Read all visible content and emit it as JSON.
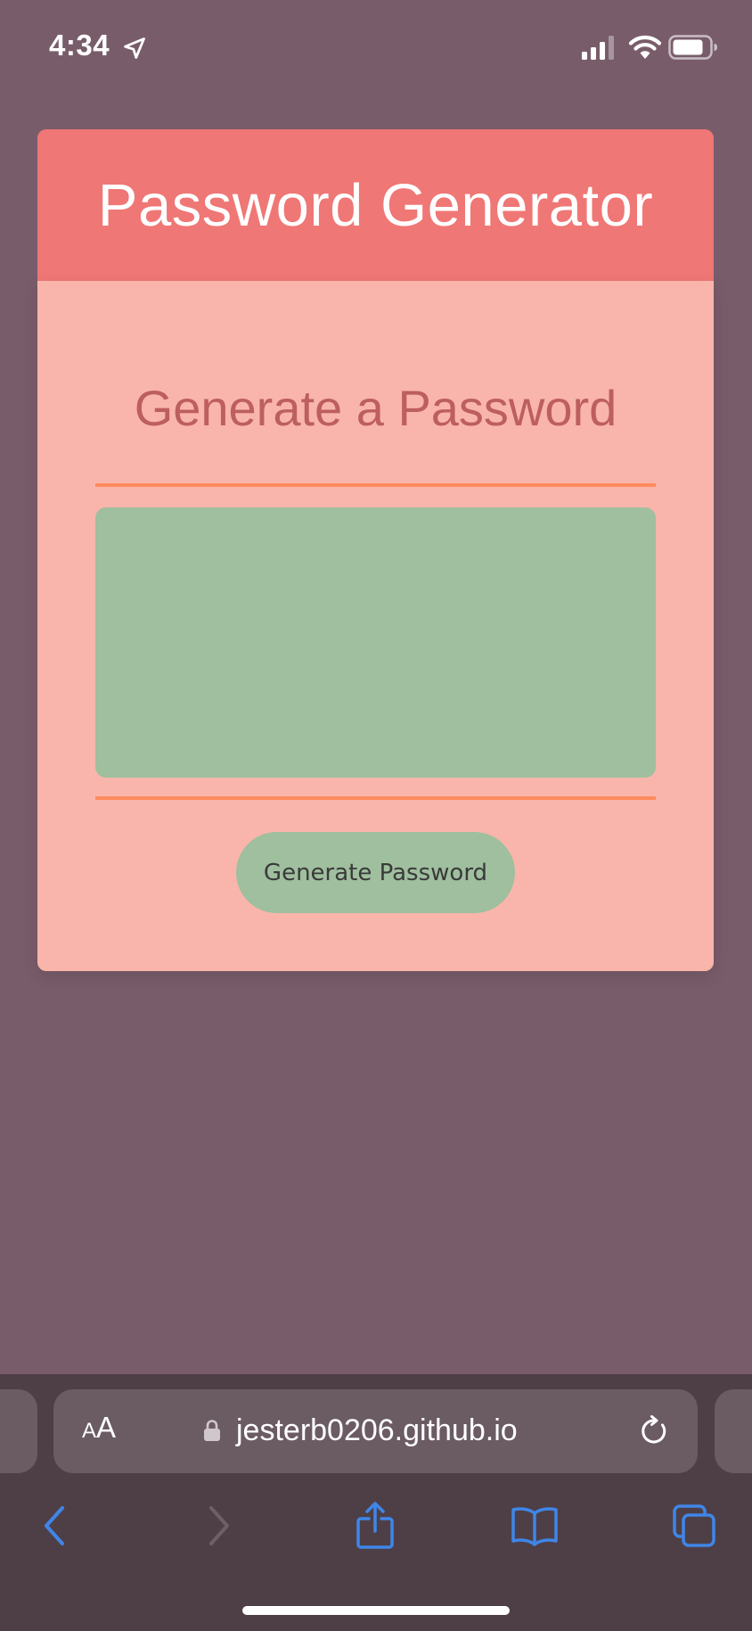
{
  "status_bar": {
    "time": "4:34",
    "icons": [
      "location-arrow-icon",
      "cellular-signal-icon",
      "wifi-icon",
      "battery-icon"
    ]
  },
  "page": {
    "title": "Password Generator",
    "card_heading": "Generate a Password",
    "password_value": "",
    "generate_button_label": "Generate Password"
  },
  "browser": {
    "text_size_label_small": "A",
    "text_size_label_large": "A",
    "url": "jesterb0206.github.io",
    "toolbar": [
      "back-icon",
      "forward-icon",
      "share-icon",
      "bookmarks-icon",
      "tabs-icon"
    ]
  },
  "colors": {
    "page_background": "#795c6a",
    "header_background": "#ef7775",
    "card_background": "#f9b5ab",
    "heading_text": "#bd5e5f",
    "divider": "#fe8a5e",
    "accent_green": "#9fbf9e",
    "browser_chrome": "#4e3f47",
    "link_blue": "#3f86e8"
  }
}
